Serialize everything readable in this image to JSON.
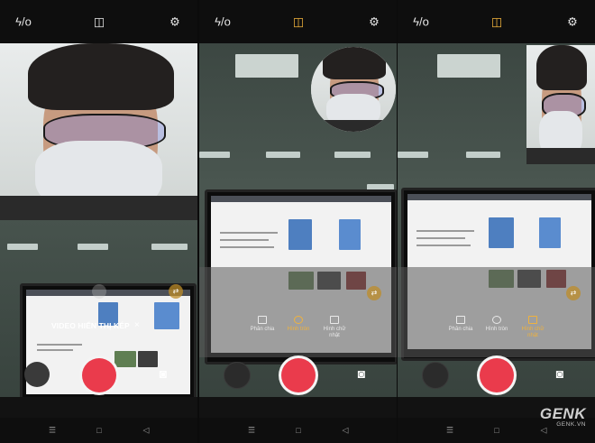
{
  "panels": [
    {
      "id": "dual-view",
      "topbar": {
        "flash": "ϟ/o",
        "layout": "◫",
        "settings": "⚙"
      },
      "banner": {
        "label": "VIDEO HIỂN THỊ KÉP",
        "close": "×"
      }
    },
    {
      "id": "circle-mode",
      "topbar": {
        "flash": "ϟ/o",
        "layout": "◫",
        "settings": "⚙"
      },
      "modes": [
        "Phân chia",
        "Hình tròn",
        "Hình chữ nhật"
      ],
      "selected_mode": "Hình tròn"
    },
    {
      "id": "rectangle-mode",
      "topbar": {
        "flash": "ϟ/o",
        "layout": "◫",
        "settings": "⚙"
      },
      "modes": [
        "Phân chia",
        "Hình tròn",
        "Hình chữ nhật"
      ],
      "selected_mode": "Hình chữ nhật"
    }
  ],
  "nav": {
    "menu": "☰",
    "home": "□",
    "back": "◁"
  },
  "watermark": {
    "brand": "GENK",
    "site": "GENK.VN"
  },
  "colors": {
    "accent": "#f0b23c",
    "shutter": "#ea3b4c"
  }
}
